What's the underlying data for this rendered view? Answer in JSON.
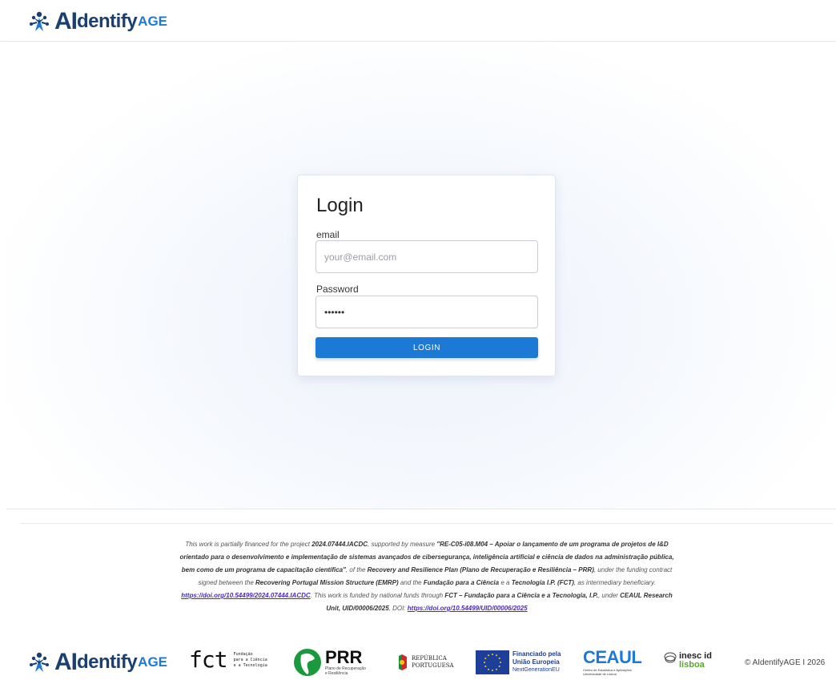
{
  "brand": {
    "ai": "AI",
    "dentify": "dentify",
    "age": "AGE"
  },
  "login": {
    "title": "Login",
    "email_label": "email",
    "email_placeholder": "your@email.com",
    "password_label": "Password",
    "password_value": "••••••",
    "button_label": "LOGIN"
  },
  "footer": {
    "funding": {
      "t1": "This work is partially financed for the project ",
      "b1": "2024.07444.IACDC",
      "t2": ", supported by measure ",
      "b2": "\"RE-C05-i08.M04 – Apoiar o lançamento de um programa de projetos de I&D orientado para o desenvolvimento e implementação de sistemas avançados de cibersegurança, inteligência artificial e ciência de dados na administração pública, bem como de um programa de capacitação científica\"",
      "t3": ", of the ",
      "b3": "Recovery and Resilience Plan (Plano de Recuperação e Resiliência – PRR)",
      "t4": ", under the funding contract signed between the ",
      "b4": "Recovering Portugal Mission Structure (EMRP)",
      "t5": " and the ",
      "b5": "Fundação para a Ciência",
      "t6": " e a ",
      "b6": "Tecnologia I.P. (FCT)",
      "t7": ", as intermediary beneficiary. ",
      "link1": "https://doi.org/10.54499/2024.07444.IACDC",
      "t8": ". This work is funded by national funds through ",
      "b7": "FCT – Fundação para a Ciência e a Tecnologia, I.P.",
      "t9": ", under ",
      "b8": "CEAUL Research Unit, UID/00006/2025",
      "t10": ", DOI: ",
      "link2": "https://doi.org/10.54499/UID/00006/2025"
    },
    "partners": {
      "fct_logo": "fct",
      "fct_text1": "Fundação",
      "fct_text2": "para a Ciência",
      "fct_text3": "e a Tecnologia",
      "prr_logo": "PRR",
      "prr_text1": "Plano de Recuperação",
      "prr_text2": "e Resiliência",
      "rep_text1": "REPÚBLICA",
      "rep_text2": "PORTUGUESA",
      "eu_text1": "Financiado pela",
      "eu_text2": "União Europeia",
      "eu_text3": "NextGenerationEU",
      "ceaul_logo": "CEAUL",
      "ceaul_sub": "Centro de Estatística e Aplicações\nUniversidade de Lisboa",
      "inesc_text1": "inesc id",
      "inesc_text2": "lisboa"
    },
    "copyright": "© AIdentifyAGE I 2026"
  },
  "colors": {
    "brand_navy": "#1c3f73",
    "brand_blue": "#1c7ad6",
    "button_blue": "#1c7ad6"
  }
}
